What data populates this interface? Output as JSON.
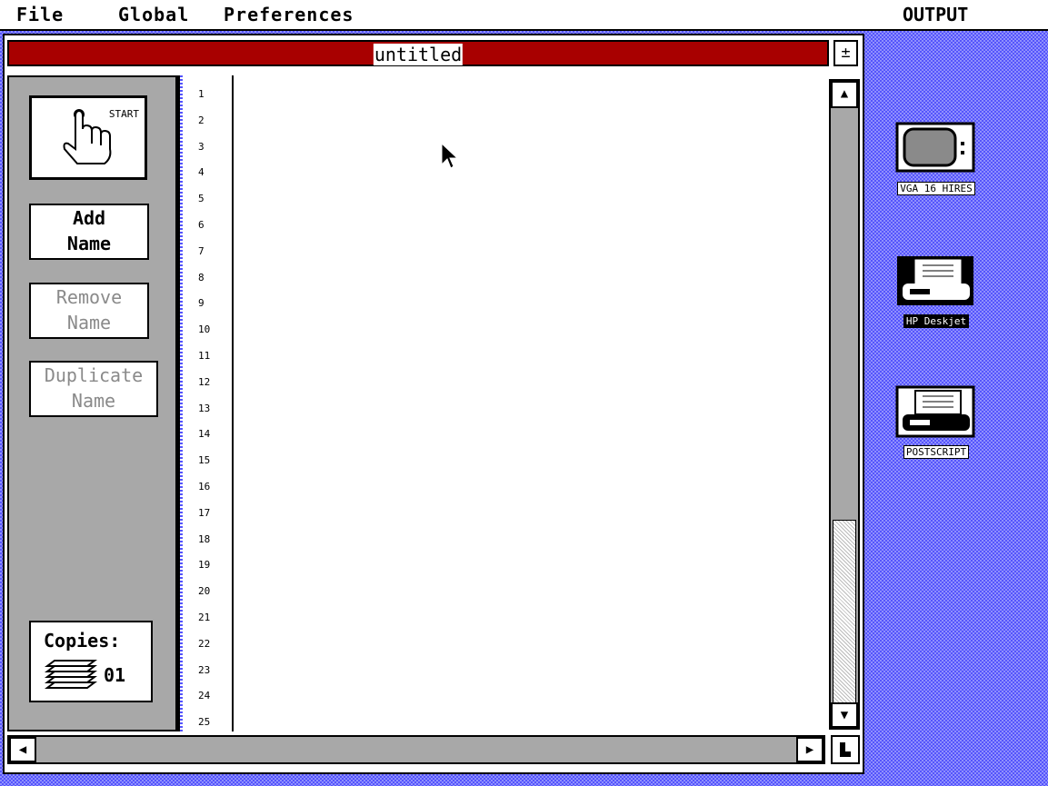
{
  "menubar": {
    "items": [
      "File",
      "Global",
      "Preferences"
    ],
    "right_label": "OUTPUT"
  },
  "window": {
    "title": "untitled",
    "maximize_glyph": "±"
  },
  "left_panel": {
    "start_label": "START",
    "add_name": [
      "Add",
      "Name"
    ],
    "remove_name": [
      "Remove",
      "Name"
    ],
    "duplicate_name": [
      "Duplicate",
      "Name"
    ],
    "copies_label": "Copies:",
    "copies_value": "01"
  },
  "line_numbers": [
    "1",
    "2",
    "3",
    "4",
    "5",
    "6",
    "7",
    "8",
    "9",
    "10",
    "11",
    "12",
    "13",
    "14",
    "15",
    "16",
    "17",
    "18",
    "19",
    "20",
    "21",
    "22",
    "23",
    "24",
    "25"
  ],
  "scroll": {
    "up": "▲",
    "down": "▼",
    "left": "◀",
    "right": "▶"
  },
  "devices": [
    {
      "label": "VGA 16 HIRES",
      "icon": "monitor-icon",
      "selected": false
    },
    {
      "label": "HP Deskjet",
      "icon": "printer-icon",
      "selected": true
    },
    {
      "label": "POSTSCRIPT",
      "icon": "printer-icon",
      "selected": false
    }
  ],
  "colors": {
    "titlebar": "#a80000",
    "desktop": "#5454fc",
    "panel": "#a8a8a8"
  }
}
